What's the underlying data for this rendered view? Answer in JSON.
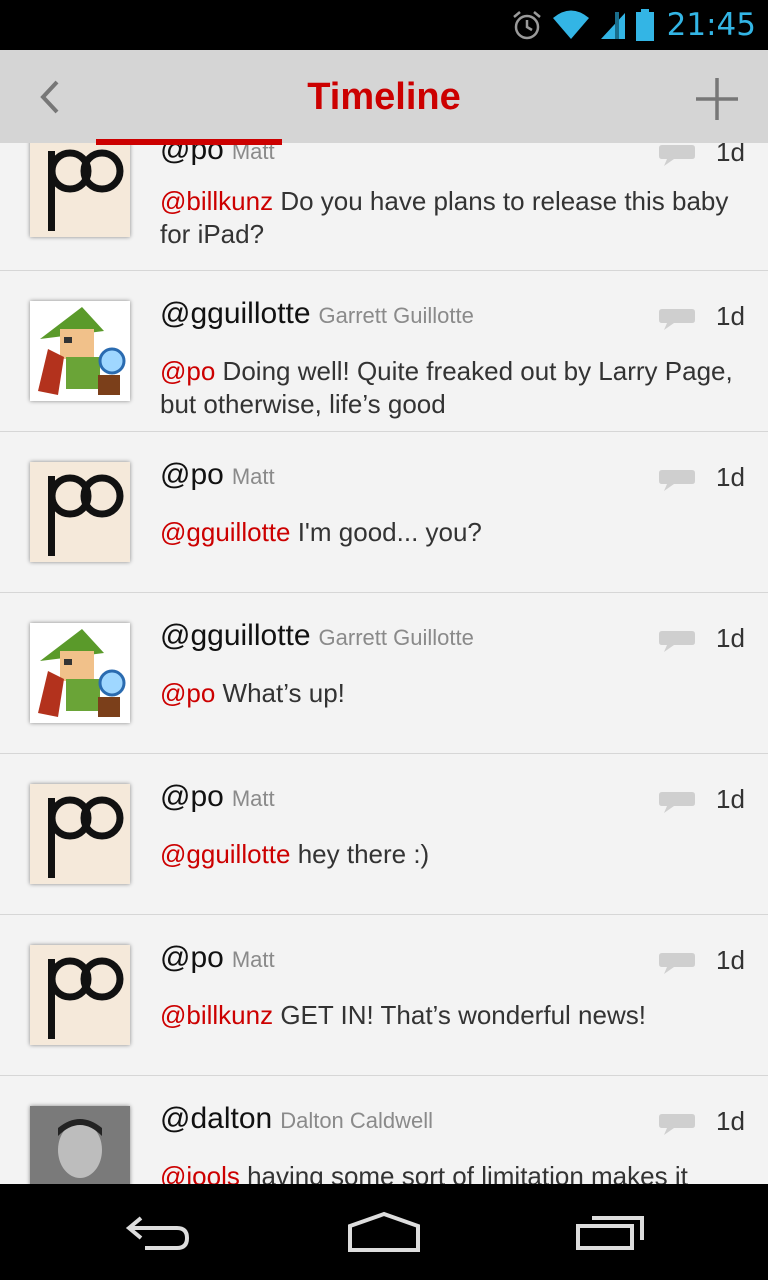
{
  "status_bar": {
    "time": "21:45",
    "icons": [
      "alarm-icon",
      "wifi-icon",
      "signal-icon",
      "battery-icon"
    ],
    "accent_color": "#33b5e5"
  },
  "action_bar": {
    "title": "Timeline",
    "back_icon": "chevron-left-icon",
    "add_icon": "plus-icon",
    "title_color": "#cc0000"
  },
  "posts": [
    {
      "handle": "@po",
      "name": "Matt",
      "age": "1d",
      "mention": "@billkunz",
      "text": " Do you have plans to release this baby for iPad?",
      "avatar": "po"
    },
    {
      "handle": "@gguillotte",
      "name": "Garrett Guillotte",
      "age": "1d",
      "mention": "@po",
      "text": " Doing well! Quite freaked out by Larry Page, but otherwise, life’s good",
      "avatar": "link"
    },
    {
      "handle": "@po",
      "name": "Matt",
      "age": "1d",
      "mention": "@gguillotte",
      "text": " I'm good... you?",
      "avatar": "po"
    },
    {
      "handle": "@gguillotte",
      "name": "Garrett Guillotte",
      "age": "1d",
      "mention": "@po",
      "text": " What’s up!",
      "avatar": "link"
    },
    {
      "handle": "@po",
      "name": "Matt",
      "age": "1d",
      "mention": "@gguillotte",
      "text": " hey there :)",
      "avatar": "po"
    },
    {
      "handle": "@po",
      "name": "Matt",
      "age": "1d",
      "mention": "@billkunz",
      "text": " GET IN! That’s wonderful news!",
      "avatar": "po"
    },
    {
      "handle": "@dalton",
      "name": "Dalton Caldwell",
      "age": "1d",
      "mention": "@jools",
      "text": " having some sort of limitation makes it",
      "avatar": "photo"
    }
  ],
  "nav_bar": {
    "buttons": [
      "back-icon",
      "home-icon",
      "recent-apps-icon"
    ]
  }
}
